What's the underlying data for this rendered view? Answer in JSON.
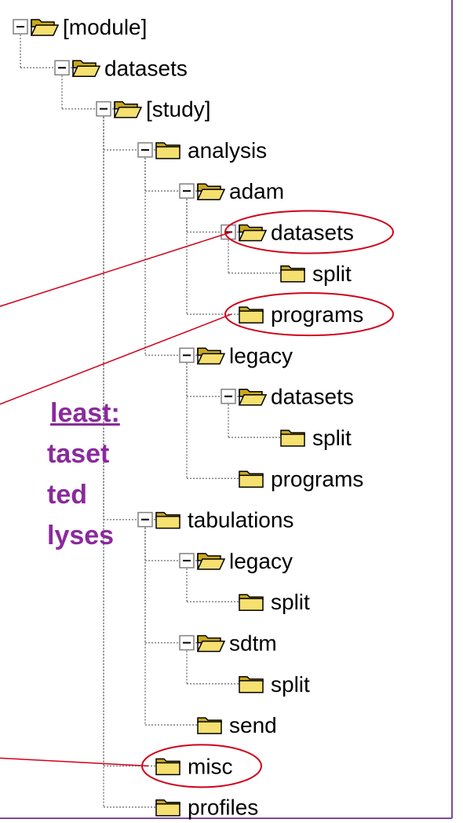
{
  "tree": {
    "nodes": [
      {
        "label": "[module]",
        "depth": 0,
        "expand": "minus",
        "icon": "open-folder-icon"
      },
      {
        "label": "datasets",
        "depth": 1,
        "expand": "minus",
        "icon": "open-folder-icon"
      },
      {
        "label": "[study]",
        "depth": 2,
        "expand": "minus",
        "icon": "open-folder-icon"
      },
      {
        "label": "analysis",
        "depth": 3,
        "expand": "minus",
        "icon": "folder-icon"
      },
      {
        "label": "adam",
        "depth": 4,
        "expand": "minus",
        "icon": "open-folder-icon"
      },
      {
        "label": "datasets",
        "depth": 5,
        "expand": "minus",
        "icon": "open-folder-icon",
        "highlighted": true
      },
      {
        "label": "split",
        "depth": 6,
        "expand": "none",
        "icon": "folder-icon"
      },
      {
        "label": "programs",
        "depth": 5,
        "expand": "none",
        "icon": "folder-icon",
        "highlighted": true
      },
      {
        "label": "legacy",
        "depth": 4,
        "expand": "minus",
        "icon": "open-folder-icon"
      },
      {
        "label": "datasets",
        "depth": 5,
        "expand": "minus",
        "icon": "open-folder-icon"
      },
      {
        "label": "split",
        "depth": 6,
        "expand": "none",
        "icon": "folder-icon"
      },
      {
        "label": "programs",
        "depth": 5,
        "expand": "none",
        "icon": "folder-icon"
      },
      {
        "label": "tabulations",
        "depth": 3,
        "expand": "minus",
        "icon": "folder-icon"
      },
      {
        "label": "legacy",
        "depth": 4,
        "expand": "minus",
        "icon": "open-folder-icon"
      },
      {
        "label": "split",
        "depth": 5,
        "expand": "none",
        "icon": "folder-icon"
      },
      {
        "label": "sdtm",
        "depth": 4,
        "expand": "minus",
        "icon": "open-folder-icon"
      },
      {
        "label": "split",
        "depth": 5,
        "expand": "none",
        "icon": "folder-icon"
      },
      {
        "label": "send",
        "depth": 4,
        "expand": "none",
        "icon": "folder-icon"
      },
      {
        "label": "misc",
        "depth": 3,
        "expand": "none",
        "icon": "folder-icon",
        "highlighted": true
      },
      {
        "label": "profiles",
        "depth": 3,
        "expand": "none",
        "icon": "folder-icon"
      }
    ]
  },
  "caption": {
    "line0": "least:",
    "line1": "taset",
    "line2": "ted",
    "line3": "lyses"
  },
  "colors": {
    "highlight": "#d0021b",
    "caption": "#8a2a9c",
    "frame": "#7a4aa0",
    "folder": "#f5e070",
    "tree_line": "#808080"
  }
}
